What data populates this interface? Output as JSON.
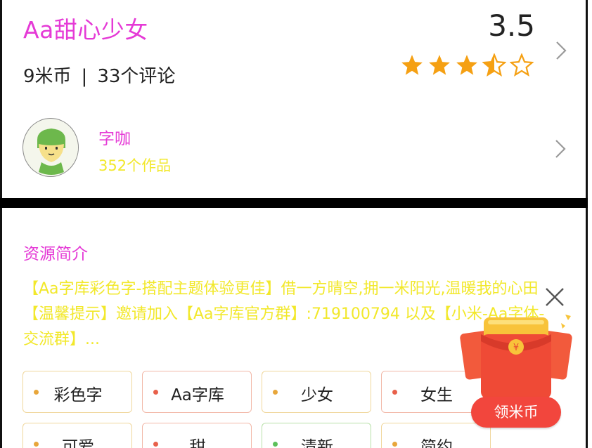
{
  "resource": {
    "font_name": "Aa甜心少女",
    "price": "9米币",
    "separator": "|",
    "comments": "33个评论",
    "rating": "3.5",
    "stars": 3.5,
    "stars_max": 5
  },
  "author": {
    "name": "字咖",
    "works": "352个作品"
  },
  "intro": {
    "title": "资源简介",
    "text": "【Aa字库彩色字-搭配主题体验更佳】借一方晴空,拥一米阳光,温暖我的心田【温馨提示】邀请加入【Aa字库官方群】:719100794 以及【小米-Aa字体-交流群】..."
  },
  "tags": [
    {
      "label": "彩色字",
      "dot": "#e8a63a"
    },
    {
      "label": "Aa字库",
      "dot": "#e8604a"
    },
    {
      "label": "少女",
      "dot": "#e8a63a"
    },
    {
      "label": "女生",
      "dot": "#e8604a"
    },
    {
      "label": "可爱",
      "dot": "#e8a63a"
    },
    {
      "label": "甜",
      "dot": "#e8604a"
    },
    {
      "label": "清新",
      "dot": "#5cc05a"
    },
    {
      "label": "简约",
      "dot": "#e8a63a"
    }
  ],
  "promo": {
    "button": "领米币"
  },
  "colors": {
    "accent_pink": "#e53ad6",
    "accent_yellow": "#f2e82b",
    "star": "#f5a013",
    "promo_red": "#f2463d"
  },
  "icons": [
    "chevron-right-icon",
    "star-icon",
    "close-icon",
    "red-envelope-icon"
  ]
}
